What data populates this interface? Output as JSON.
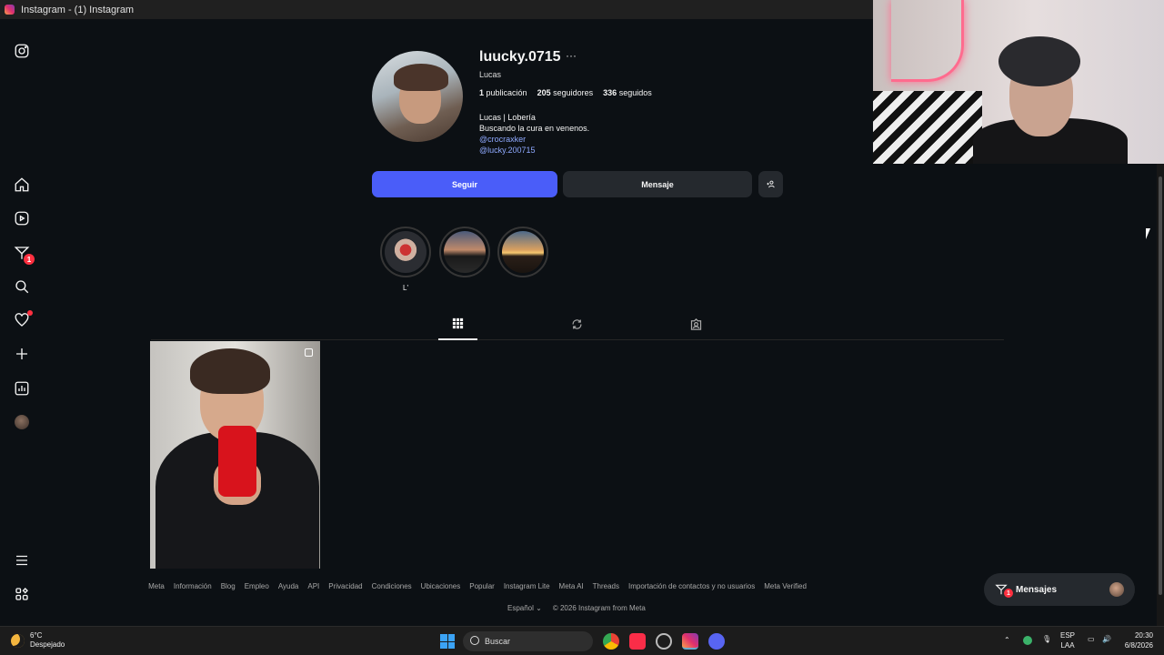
{
  "window": {
    "title": "Instagram - (1) Instagram"
  },
  "sidebar": {
    "items": [
      {
        "name": "instagram-logo-icon"
      },
      {
        "name": "home-icon"
      },
      {
        "name": "reels-icon"
      },
      {
        "name": "messages-icon",
        "badge": "1"
      },
      {
        "name": "search-icon"
      },
      {
        "name": "notifications-icon"
      },
      {
        "name": "create-icon"
      },
      {
        "name": "dashboard-icon"
      },
      {
        "name": "profile-avatar"
      },
      {
        "name": "menu-icon"
      },
      {
        "name": "more-apps-icon"
      }
    ]
  },
  "profile": {
    "username": "luucky.0715",
    "more": "···",
    "full_name": "Lucas",
    "posts_count": "1",
    "posts_label": "publicación",
    "followers_count": "205",
    "followers_label": "seguidores",
    "following_count": "336",
    "following_label": "seguidos",
    "bio_line1": "Lucas | Lobería",
    "bio_line2": "Buscando la cura en venenos.",
    "bio_link1": "@crocraxker",
    "bio_link2": "@lucky.200715",
    "follow_button": "Seguir",
    "message_button": "Mensaje"
  },
  "highlights": [
    {
      "label": "L'"
    },
    {
      "label": ""
    },
    {
      "label": ""
    }
  ],
  "tabs": [
    "posts-grid-icon",
    "reposts-icon",
    "tagged-icon"
  ],
  "footer": {
    "links": [
      "Meta",
      "Información",
      "Blog",
      "Empleo",
      "Ayuda",
      "API",
      "Privacidad",
      "Condiciones",
      "Ubicaciones",
      "Popular",
      "Instagram Lite",
      "Meta AI",
      "Threads",
      "Importación de contactos y no usuarios",
      "Meta Verified"
    ],
    "language": "Español",
    "copyright": "© 2026 Instagram from Meta"
  },
  "messages_pill": {
    "label": "Mensajes",
    "badge": "1"
  },
  "taskbar": {
    "weather_temp": "6°C",
    "weather_desc": "Despejado",
    "search_placeholder": "Buscar",
    "lang1": "ESP",
    "lang2": "LAA",
    "time": "20:30",
    "date": "6/8/2026"
  },
  "colors": {
    "accent": "#4a5df9",
    "background": "#0c1014",
    "badge": "#ff3040"
  }
}
